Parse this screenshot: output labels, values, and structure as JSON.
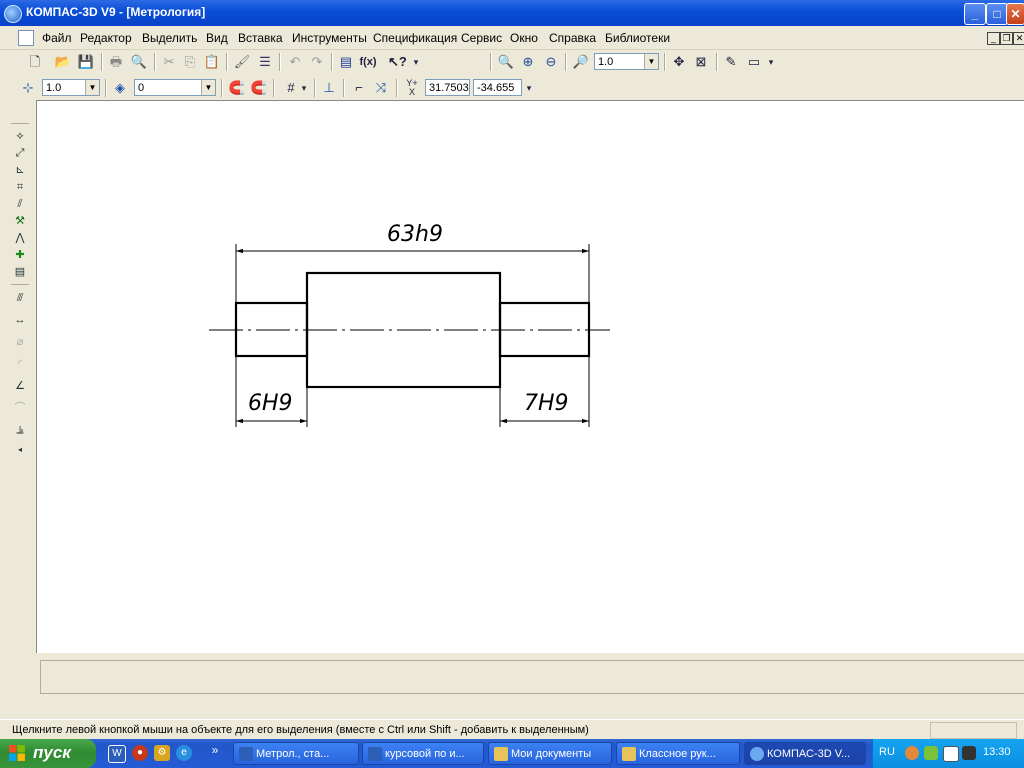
{
  "window": {
    "title": "КОМПАС-3D V9 - [Метрология]"
  },
  "menu": {
    "items": [
      "Файл",
      "Редактор",
      "Выделить",
      "Вид",
      "Вставка",
      "Инструменты",
      "Спецификация",
      "Сервис",
      "Окно",
      "Справка",
      "Библиотеки"
    ]
  },
  "toolbar1": {
    "zoom_value": "1.0"
  },
  "toolbar2": {
    "scale_value": "1.0",
    "layer_value": "0",
    "coord_x": "31.7503",
    "coord_y": "-34.655",
    "coord_prefix": "Y",
    "coord_sub": "X"
  },
  "drawing": {
    "dim_total": "63h9",
    "dim_left": "6H9",
    "dim_right": "7H9"
  },
  "status": {
    "message": "Щелкните левой кнопкой мыши на объекте для его выделения (вместе с Ctrl или Shift - добавить к выделенным)"
  },
  "taskbar": {
    "start_label": "пуск",
    "tasks": [
      "Метрол., ста...",
      "курсовой по и...",
      "Мои документы",
      "Классное рук...",
      "КОМПАС-3D V..."
    ],
    "language": "RU",
    "clock": "13:30"
  }
}
